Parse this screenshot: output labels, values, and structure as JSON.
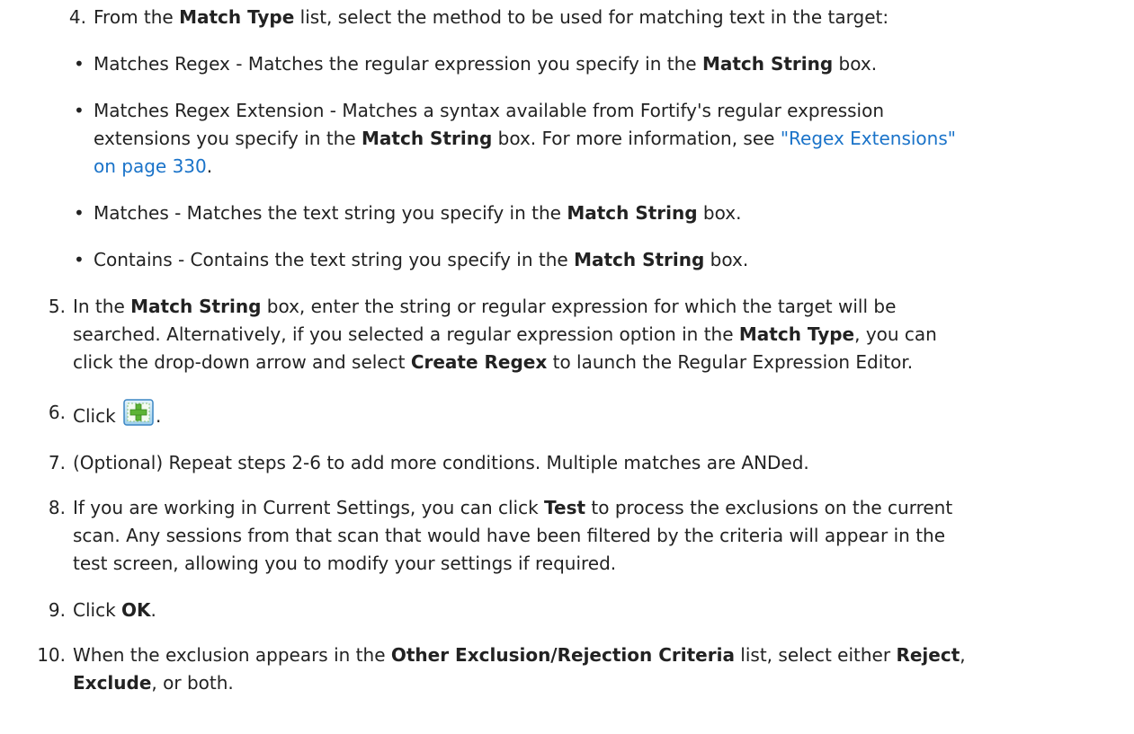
{
  "steps": {
    "s4": {
      "num": "4.",
      "pre": "From the ",
      "b1": "Match Type",
      "post": " list, select the method to be used for matching text in the target:"
    },
    "bullets": {
      "b1": {
        "pre": "Matches Regex - Matches the regular expression you specify in the ",
        "bold": "Match String",
        "post": " box."
      },
      "b2": {
        "line1": "Matches Regex Extension - Matches a syntax available from Fortify's regular expression",
        "line2_pre": "extensions you specify in the ",
        "line2_bold": "Match String",
        "line2_mid": " box. For more information, see ",
        "line2_link": "\"Regex Extensions\"",
        "line3_link": "on page 330",
        "line3_post": "."
      },
      "b3": {
        "pre": "Matches - Matches the text string you specify in the ",
        "bold": "Match String",
        "post": " box."
      },
      "b4": {
        "pre": "Contains - Contains the text string you specify in the ",
        "bold": "Match String",
        "post": " box."
      }
    },
    "s5": {
      "num": "5.",
      "l1_pre": "In the ",
      "l1_bold": "Match String",
      "l1_post": " box, enter the string or regular expression for which the target will be",
      "l2_pre": "searched. Alternatively, if you selected a regular expression option in the ",
      "l2_bold": "Match Type",
      "l2_post": ", you can",
      "l3_pre": "click the drop-down arrow and select ",
      "l3_bold": "Create Regex",
      "l3_post": " to launch the Regular Expression Editor."
    },
    "s6": {
      "num": "6.",
      "pre": "Click ",
      "post": "."
    },
    "s7": {
      "num": "7.",
      "text": "(Optional) Repeat steps 2-6 to add more conditions. Multiple matches are ANDed."
    },
    "s8": {
      "num": "8.",
      "l1_pre": "If you are working in Current Settings, you can click ",
      "l1_bold": "Test",
      "l1_post": " to process the exclusions on the current",
      "l2": "scan. Any sessions from that scan that would have been filtered by the criteria will appear in the",
      "l3": "test screen, allowing you to modify your settings if required."
    },
    "s9": {
      "num": "9.",
      "pre": "Click ",
      "bold": "OK",
      "post": "."
    },
    "s10": {
      "num": "10.",
      "l1_pre": "When the exclusion appears in the ",
      "l1_bold": "Other Exclusion/Rejection Criteria",
      "l1_mid": " list, select either ",
      "l1_bold2": "Reject",
      "l1_post": ",",
      "l2_bold": "Exclude",
      "l2_post": ", or both."
    }
  },
  "icons": {
    "add_condition": "add-condition-icon"
  },
  "colors": {
    "text": "#222222",
    "link": "#1a73c9"
  }
}
